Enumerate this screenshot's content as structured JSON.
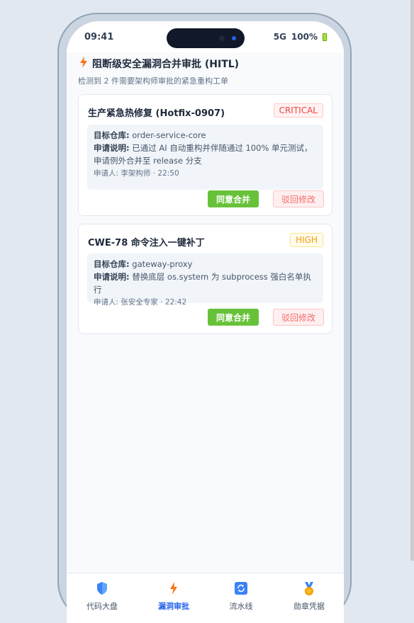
{
  "status": {
    "time": "09:41",
    "network": "5G",
    "battery": "100%"
  },
  "header": {
    "title": "阻断级安全漏洞合并审批 (HITL)",
    "subtitle": "检测到 2 件需要架构师审批的紧急重构工单"
  },
  "cards": [
    {
      "title": "生产紧急热修复 (Hotfix-0907)",
      "badge": "CRITICAL",
      "repo_label": "目标仓库:",
      "repo": "order-service-core",
      "desc_label": "申请说明:",
      "desc": "已通过 AI 自动重构并伴随通过 100% 单元测试，申请例外合并至 release 分支",
      "meta": "申请人: 李架构师 · 22:50",
      "approve": "同意合并",
      "reject": "驳回修改"
    },
    {
      "title": "CWE-78 命令注入一键补丁",
      "badge": "HIGH",
      "repo_label": "目标仓库:",
      "repo": "gateway-proxy",
      "desc_label": "申请说明:",
      "desc": "替换底层 os.system 为 subprocess 强白名单执行",
      "meta": "申请人: 张安全专家 · 22:42",
      "approve": "同意合并",
      "reject": "驳回修改"
    }
  ],
  "tabs": [
    {
      "label": "代码大盘",
      "icon": "shield-icon"
    },
    {
      "label": "漏洞审批",
      "icon": "lightning-icon"
    },
    {
      "label": "流水线",
      "icon": "refresh-icon"
    },
    {
      "label": "勋章凭据",
      "icon": "medal-icon"
    }
  ],
  "colors": {
    "approve": "#67c23a",
    "reject": "#f56c6c",
    "active_tab": "#2563eb",
    "critical": "#ef4444",
    "high": "#f59e0b"
  }
}
